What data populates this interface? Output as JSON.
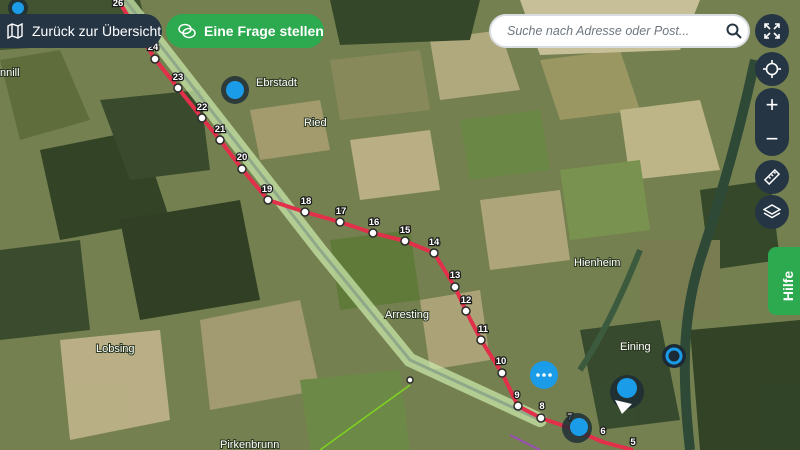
{
  "toolbar": {
    "back_label": "Zurück zur Übersicht",
    "ask_label": "Eine Frage stellen",
    "help_label": "Hilfe"
  },
  "search": {
    "placeholder": "Suche nach Adresse oder Post...",
    "icon": "search-icon"
  },
  "map_controls": [
    {
      "name": "fullscreen",
      "icon": "expand-icon"
    },
    {
      "name": "locate",
      "icon": "crosshair-icon"
    },
    {
      "name": "zoom-in",
      "label": "+"
    },
    {
      "name": "zoom-out",
      "label": "−"
    },
    {
      "name": "measure",
      "icon": "ruler-icon"
    },
    {
      "name": "layers",
      "icon": "layers-icon"
    }
  ],
  "route": {
    "color": "#e2304a",
    "corridor_color": "#c8e6a8",
    "markers": [
      "26",
      "24",
      "23",
      "22",
      "21",
      "20",
      "19",
      "18",
      "17",
      "16",
      "15",
      "14",
      "13",
      "12",
      "11",
      "10",
      "9",
      "8",
      "7",
      "6",
      "5"
    ]
  },
  "places": [
    "nnill",
    "Ebrstadt",
    "Ried",
    "Arresting",
    "Hienheim",
    "Lobsing",
    "Eining",
    "Pirkenbrunn"
  ],
  "colors": {
    "dark_navy": "#253544",
    "green": "#2da94f",
    "pin_blue": "#1a9ce8"
  }
}
